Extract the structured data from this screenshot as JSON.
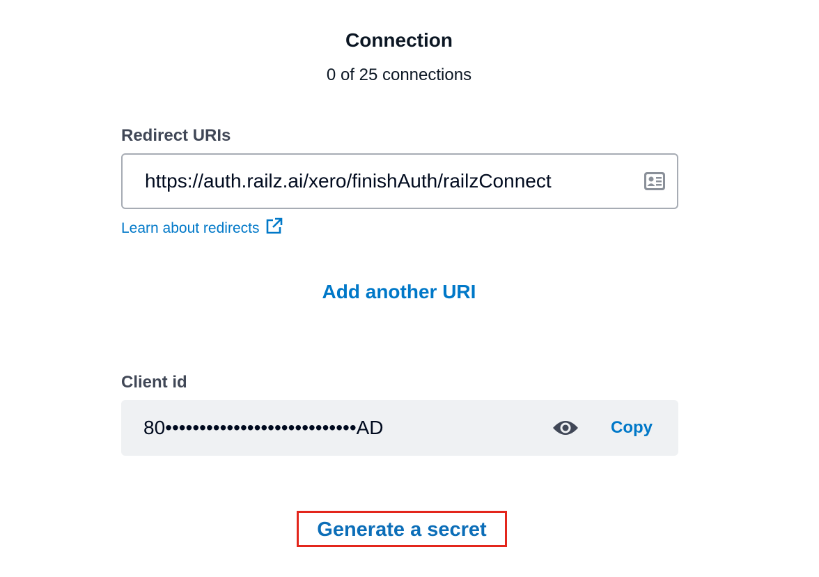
{
  "section": {
    "title": "Connection",
    "subtitle": "0 of 25 connections"
  },
  "redirect": {
    "label": "Redirect URIs",
    "value": "https://auth.railz.ai/xero/finishAuth/railzConnect",
    "field_icon": "contact-card-icon",
    "learn_link": "Learn about redirects",
    "learn_icon": "external-link-icon",
    "add_label": "Add another URI"
  },
  "client": {
    "label": "Client id",
    "value": "80••••••••••••••••••••••••••••AD",
    "reveal_icon": "eye-icon",
    "copy_label": "Copy"
  },
  "secret": {
    "generate_label": "Generate a secret"
  },
  "colors": {
    "link": "#0078c8",
    "highlight_border": "#e3261c",
    "field_border": "#a7acb4",
    "readonly_bg": "#eff1f3"
  }
}
